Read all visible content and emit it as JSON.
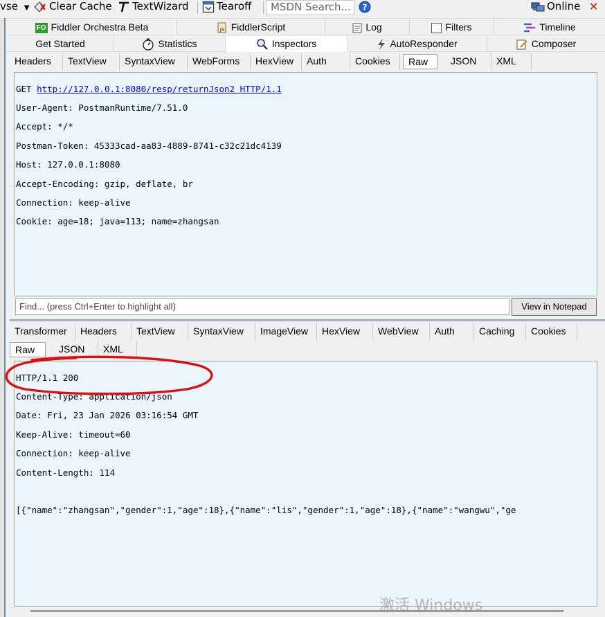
{
  "toolbar": {
    "partial_label": "vse",
    "clear_cache": "Clear Cache",
    "text_wizard": "TextWizard",
    "tearoff": "Tearoff",
    "search_placeholder": "MSDN Search...",
    "online": "Online"
  },
  "tabs_row1": [
    {
      "label": "Fiddler Orchestra Beta",
      "icon": "fo-icon"
    },
    {
      "label": "FiddlerScript",
      "icon": "script-icon"
    },
    {
      "label": "Log",
      "icon": "log-icon"
    },
    {
      "label": "Filters",
      "icon": "checkbox-icon"
    },
    {
      "label": "Timeline",
      "icon": "timeline-icon"
    }
  ],
  "tabs_row2": [
    {
      "label": "Get Started"
    },
    {
      "label": "Statistics",
      "icon": "stopwatch-icon"
    },
    {
      "label": "Inspectors",
      "icon": "magnifier-icon",
      "active": true
    },
    {
      "label": "AutoResponder",
      "icon": "lightning-icon"
    },
    {
      "label": "Composer",
      "icon": "composer-icon"
    }
  ],
  "request_tabs": [
    "Headers",
    "TextView",
    "SyntaxView",
    "WebForms",
    "HexView",
    "Auth",
    "Cookies",
    "Raw",
    "JSON",
    "XML"
  ],
  "request_active_tab": "Raw",
  "request": {
    "method": "GET",
    "url": "http://127.0.0.1:8080/resp/returnJson2 HTTP/1.1",
    "lines": [
      "User-Agent: PostmanRuntime/7.51.0",
      "Accept: */*",
      "Postman-Token: 45333cad-aa83-4889-8741-c32c21dc4139",
      "Host: 127.0.0.1:8080",
      "Accept-Encoding: gzip, deflate, br",
      "Connection: keep-alive",
      "Cookie: age=18; java=113; name=zhangsan"
    ]
  },
  "find": {
    "placeholder": "Find... (press Ctrl+Enter to highlight all)",
    "button": "View in Notepad"
  },
  "response_tabs": [
    "Transformer",
    "Headers",
    "TextView",
    "SyntaxView",
    "ImageView",
    "HexView",
    "WebView",
    "Auth",
    "Caching",
    "Cookies"
  ],
  "response_subtabs": [
    "Raw",
    "JSON",
    "XML"
  ],
  "response_active_tab": "Raw",
  "response": {
    "lines": [
      "HTTP/1.1 200",
      "Content-Type: application/json",
      "Date: Fri, 23 Jan 2026 03:16:54 GMT",
      "Keep-Alive: timeout=60",
      "Connection: keep-alive",
      "Content-Length: 114"
    ],
    "body": "[{\"name\":\"zhangsan\",\"gender\":1,\"age\":18},{\"name\":\"lis\",\"gender\":1,\"age\":18},{\"name\":\"wangwu\",\"ge"
  },
  "watermark": "激活 Windows",
  "colors": {
    "pane_bg": "#eaf6fc",
    "annotation_red": "#e01010",
    "link_blue": "#0000ee"
  }
}
